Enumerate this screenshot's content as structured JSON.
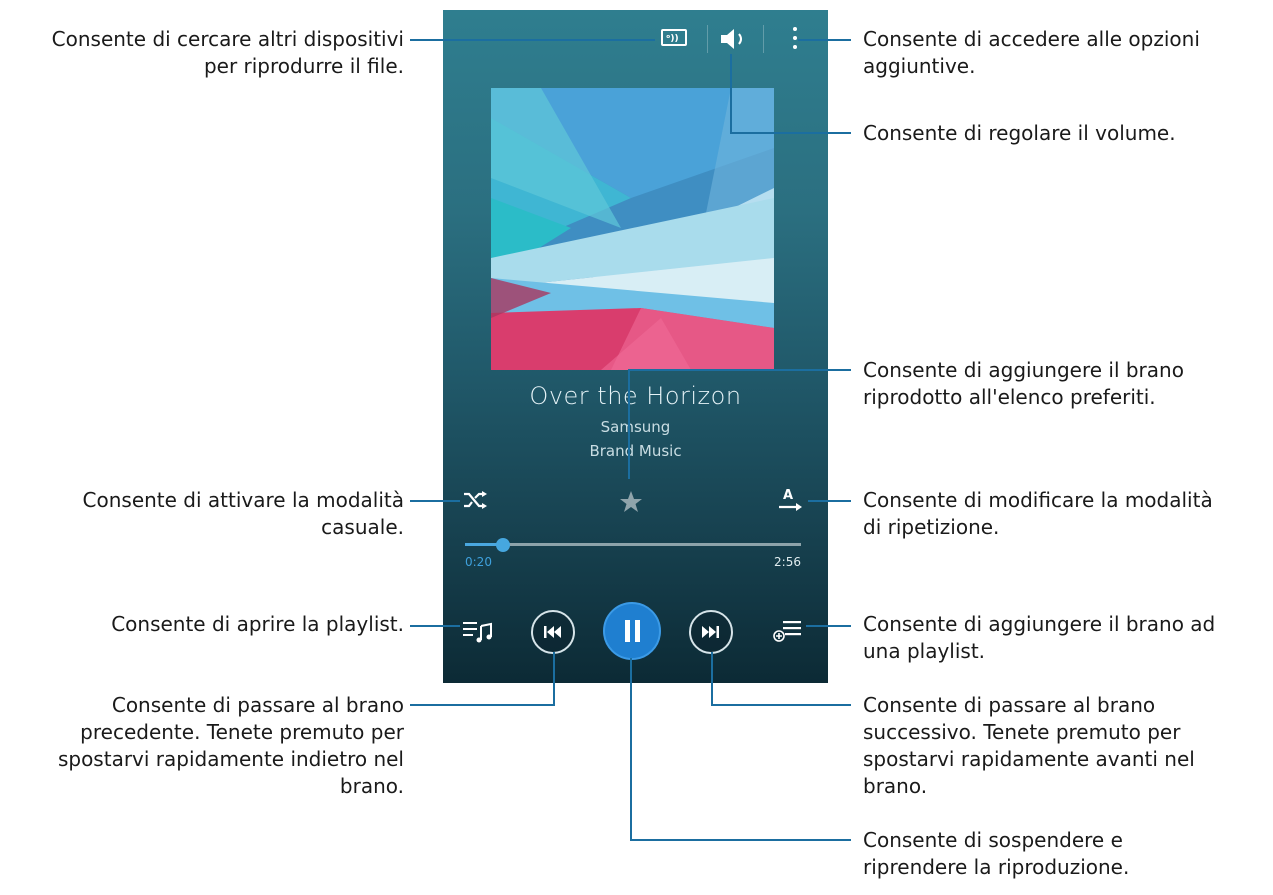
{
  "player": {
    "cast_label": "ᵒ))",
    "song_title": "Over the Horizon",
    "artist": "Samsung",
    "album": "Brand Music",
    "time_elapsed": "0:20",
    "time_total": "2:56",
    "progress": 0.114,
    "accent_color": "#1f7fd0",
    "repeat_label": "A"
  },
  "callouts": {
    "cast": "Consente di cercare altri dispositivi\nper riprodurre il file.",
    "options": "Consente di accedere alle opzioni\naggiuntive.",
    "volume": "Consente di regolare il volume.",
    "favorite": "Consente di aggiungere il brano\nriprodotto all'elenco preferiti.",
    "shuffle": "Consente di attivare la modalità\ncasuale.",
    "repeat": "Consente di modificare la modalità\ndi ripetizione.",
    "playlist_open": "Consente di aprire la playlist.",
    "playlist_add": "Consente di aggiungere il brano ad\nuna playlist.",
    "previous": "Consente di passare al brano\nprecedente. Tenete premuto per\nspostarvi rapidamente indietro nel\nbrano.",
    "next": "Consente di passare al brano\nsuccessivo. Tenete premuto per\nspostarvi rapidamente avanti nel\nbrano.",
    "pause": "Consente di sospendere e\nriprendere la riproduzione."
  },
  "icons": {
    "cast": "screen-mirroring-icon",
    "volume": "speaker-icon",
    "options": "more-vertical-icon",
    "shuffle": "shuffle-icon",
    "favorite": "star-icon",
    "repeat": "repeat-a-icon",
    "playlist": "playlist-icon",
    "previous": "skip-previous-icon",
    "pause": "pause-icon",
    "next": "skip-next-icon",
    "add_to_playlist": "add-to-playlist-icon"
  }
}
